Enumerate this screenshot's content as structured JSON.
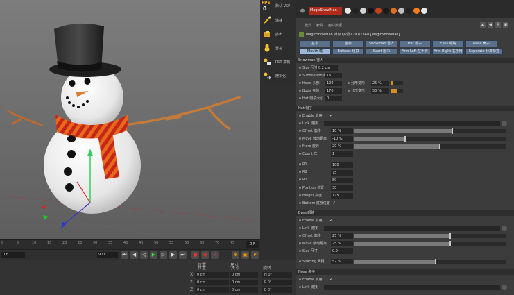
{
  "object_manager": {
    "fps_label": "FPS",
    "fps_value": "0",
    "header_label": "默认 VSP",
    "tools": [
      {
        "label": "涂抹",
        "icon": "brush-icon"
      },
      {
        "label": "挤出",
        "icon": "extrude-icon"
      },
      {
        "label": "雪花",
        "icon": "snowman-icon"
      },
      {
        "label": "PSR 复制",
        "icon": "psr-icon"
      },
      {
        "label": "随机化",
        "icon": "random-icon"
      }
    ],
    "object_name": "MagicSnowMan",
    "material_colors": [
      "#e8e8e8",
      "#222222",
      "#d5d5d5",
      "#111111",
      "#c7411a",
      "#1a1a1a",
      "#e07020",
      "#c0c0c0",
      "#222222",
      "#ff7a1a",
      "#e8e8e8",
      "#1a1a1a",
      "#ffffff"
    ]
  },
  "attribute_manager": {
    "menu": [
      "模式",
      "编辑",
      "用户数据"
    ],
    "title": "MagicSnowMan 对象 Q2群1797/1348 [MagicSnowMan]",
    "tabs_row1": [
      "基本",
      "坐标",
      "Snowman 雪人",
      "Hat 帽子",
      "Eyes 眼睛",
      "Nose 鼻子"
    ],
    "tabs_row2": [
      "Mouth 嘴",
      "Buttons 纽扣",
      "Scarf 围巾",
      "Arm Left 左手臂",
      "Arm Right 右手臂",
      "Seperate 分离标签"
    ],
    "active_tab": "Mouth 嘴",
    "snowman": {
      "header": "Snowman 雪人",
      "size_label": "Size 尺寸",
      "size_value": "0.2 cm",
      "subdiv_label": "Subdivision 细分",
      "subdiv_value": "16",
      "headsize_label": "Head 头部",
      "headsize_value": "120",
      "ratio_label": "分形变形",
      "ratio_value": "25 %",
      "body_label": "Body 身体",
      "body_value": "170",
      "ratio2_label": "分形变形",
      "ratio2_value": "50 %",
      "hat_label": "Hat 帽子大小",
      "hat_value": "0"
    },
    "hat": {
      "header": "Hat 帽子",
      "enable_label": "Enable 启用",
      "link_label": "Link 链接",
      "offset_label": "Offset 偏移",
      "offset_value": "10 %",
      "offset_fill": 0.64,
      "move_label": "Move 移动距离",
      "move_value": "-10 %",
      "move_fill": 0.33,
      "more_label": "More 旋转",
      "more_value": "20 %",
      "more_fill": 0.56,
      "count_label": "Count 次",
      "count_value": "1"
    },
    "buttons_params": [
      {
        "label": "R1",
        "value": "100"
      },
      {
        "label": "R2",
        "value": "75"
      },
      {
        "label": "R3",
        "value": "80"
      },
      {
        "label": "Position 位置",
        "value": "30"
      },
      {
        "label": "Height 高度",
        "value": "175"
      },
      {
        "label": "Bottom 底部位置",
        "value": ""
      }
    ],
    "eyes": {
      "header": "Eyes 眼睛",
      "enable_label": "Enable 启用",
      "link_label": "Link 链接",
      "offset_label": "Offset 偏移",
      "offset_value": "25 %",
      "offset_fill": 0.63,
      "move_label": "Move 移动距离",
      "move_value": "25 %",
      "move_fill": 0.63,
      "size_label": "Size 尺寸",
      "size_value": "0.9",
      "spacing_label": "Spacing 间距",
      "spacing_value": "52 %",
      "spacing_fill": 0.53
    },
    "nose": {
      "header": "Nose 鼻子",
      "enable_label": "Enable 启用",
      "link_label": "Link 链接"
    }
  },
  "timeline": {
    "ticks": [
      "0",
      "5",
      "10",
      "15",
      "20",
      "25",
      "30",
      "35",
      "40",
      "45",
      "50",
      "55",
      "60",
      "65",
      "70",
      "75",
      "80",
      "85",
      "90"
    ],
    "current_frame": "0 F",
    "start_field": "0 F",
    "end_field": "90 F"
  },
  "coordinates": {
    "headers": [
      "位置",
      "尺寸",
      "旋转"
    ],
    "axes": [
      "X",
      "Y",
      "Z"
    ],
    "position": [
      "0 cm",
      "0 cm",
      "0 cm"
    ],
    "size": [
      "0 cm",
      "0 cm",
      "0 cm"
    ],
    "rotation": [
      "H  0°",
      "P  0°",
      "B  0°"
    ]
  }
}
